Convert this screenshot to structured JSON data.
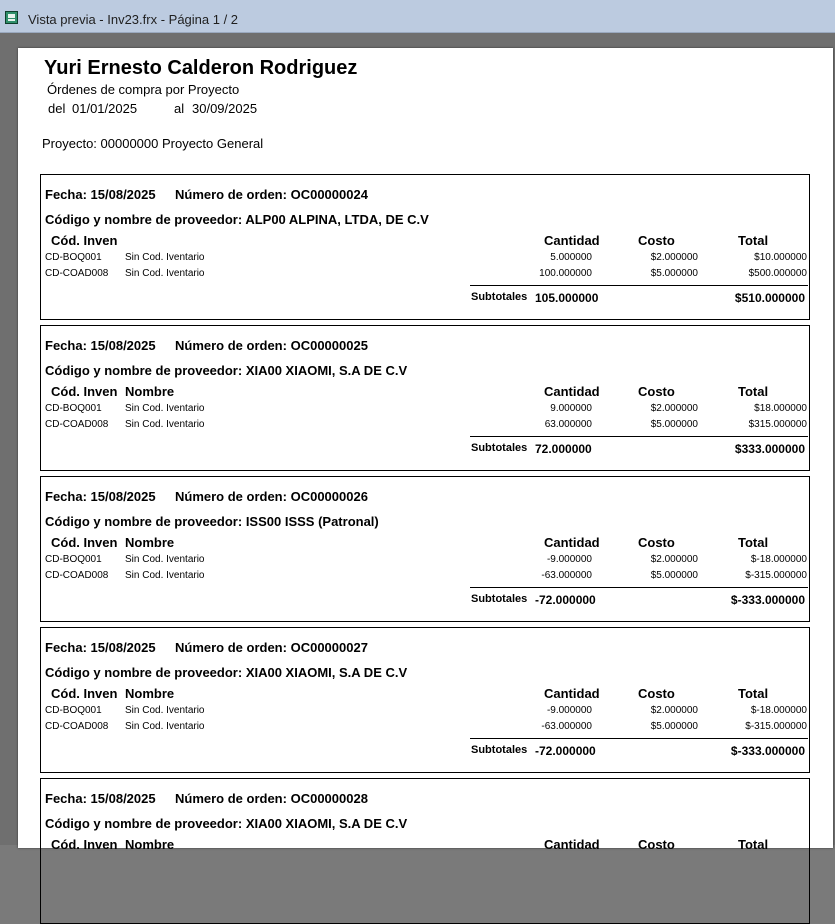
{
  "window": {
    "title": "Vista previa - Inv23.frx - Página 1 / 2",
    "icon": "report-icon"
  },
  "report": {
    "company": "Yuri Ernesto Calderon Rodriguez",
    "subtitle": "Órdenes de compra por Proyecto",
    "from_label": "del",
    "from_date": "01/01/2025",
    "to_label": "al",
    "to_date": "30/09/2025",
    "project": "Proyecto: 00000000 Proyecto General"
  },
  "labels": {
    "fecha": "Fecha:",
    "numero": "Número de orden:",
    "proveedor": "Código y nombre de proveedor:",
    "cod": "Cód. Inven",
    "nombre": "Nombre",
    "cantidad": "Cantidad",
    "costo": "Costo",
    "total": "Total",
    "subtotales": "Subtotales"
  },
  "orders": [
    {
      "fecha": "15/08/2025",
      "numero": "OC00000024",
      "proveedor": "ALP00 ALPINA, LTDA, DE C.V",
      "show_nombre": false,
      "items": [
        {
          "code": "CD-BOQ001",
          "name": "Sin Cod. Iventario",
          "qty": "5.000000",
          "cost": "$2.000000",
          "total": "$10.000000"
        },
        {
          "code": "CD-COAD008",
          "name": "Sin Cod. Iventario",
          "qty": "100.000000",
          "cost": "$5.000000",
          "total": "$500.000000"
        }
      ],
      "sub_qty": "105.000000",
      "sub_total": "$510.000000"
    },
    {
      "fecha": "15/08/2025",
      "numero": "OC00000025",
      "proveedor": "XIA00 XIAOMI, S.A DE C.V",
      "show_nombre": true,
      "items": [
        {
          "code": "CD-BOQ001",
          "name": "Sin Cod. Iventario",
          "qty": "9.000000",
          "cost": "$2.000000",
          "total": "$18.000000"
        },
        {
          "code": "CD-COAD008",
          "name": "Sin Cod. Iventario",
          "qty": "63.000000",
          "cost": "$5.000000",
          "total": "$315.000000"
        }
      ],
      "sub_qty": "72.000000",
      "sub_total": "$333.000000"
    },
    {
      "fecha": "15/08/2025",
      "numero": "OC00000026",
      "proveedor": "ISS00 ISSS (Patronal)",
      "show_nombre": true,
      "items": [
        {
          "code": "CD-BOQ001",
          "name": "Sin Cod. Iventario",
          "qty": "-9.000000",
          "cost": "$2.000000",
          "total": "$-18.000000"
        },
        {
          "code": "CD-COAD008",
          "name": "Sin Cod. Iventario",
          "qty": "-63.000000",
          "cost": "$5.000000",
          "total": "$-315.000000"
        }
      ],
      "sub_qty": "-72.000000",
      "sub_total": "$-333.000000"
    },
    {
      "fecha": "15/08/2025",
      "numero": "OC00000027",
      "proveedor": "XIA00 XIAOMI, S.A DE C.V",
      "show_nombre": true,
      "items": [
        {
          "code": "CD-BOQ001",
          "name": "Sin Cod. Iventario",
          "qty": "-9.000000",
          "cost": "$2.000000",
          "total": "$-18.000000"
        },
        {
          "code": "CD-COAD008",
          "name": "Sin Cod. Iventario",
          "qty": "-63.000000",
          "cost": "$5.000000",
          "total": "$-315.000000"
        }
      ],
      "sub_qty": "-72.000000",
      "sub_total": "$-333.000000"
    },
    {
      "fecha": "15/08/2025",
      "numero": "OC00000028",
      "proveedor": "XIA00 XIAOMI, S.A DE C.V",
      "show_nombre": true,
      "items": [],
      "sub_qty": "",
      "sub_total": ""
    }
  ]
}
